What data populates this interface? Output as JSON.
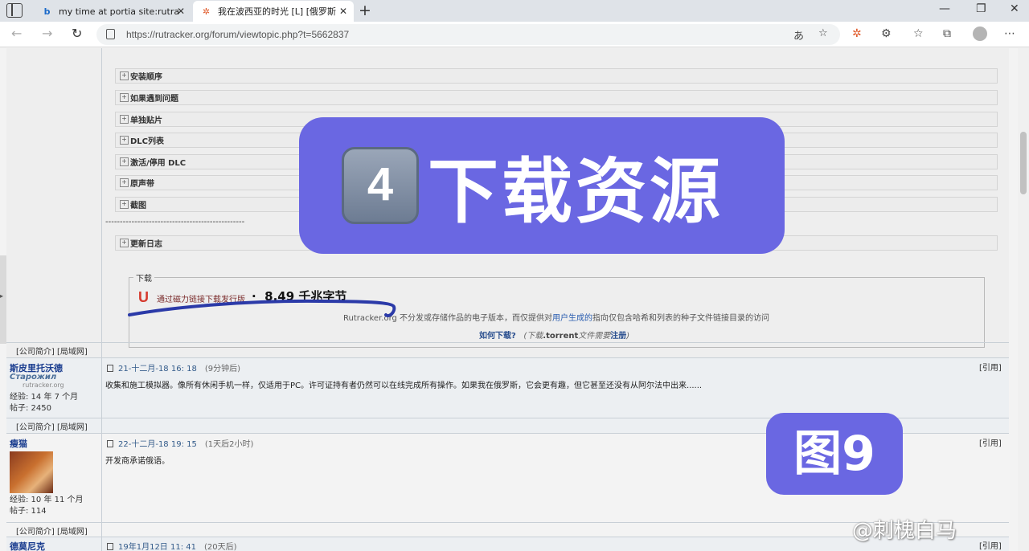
{
  "browser": {
    "tabs": [
      {
        "title": "my time at portia site:rutracker.o",
        "favicon": "bing-icon"
      },
      {
        "title": "我在波西亚的时光 [L] [俄罗斯 + ...",
        "favicon": "rutracker-icon"
      }
    ],
    "url": "https://rutracker.org/forum/viewtopic.php?t=5662837",
    "translate_icon": "あ"
  },
  "spoilers": [
    "安装顺序",
    "如果遇到问题",
    "单独贴片",
    "DLC列表",
    "激活/停用 DLC",
    "原声带",
    "截图"
  ],
  "changelog": "更新日志",
  "separator": "------------------------------------------------",
  "download": {
    "legend": "下载",
    "magnet_icon": "U",
    "magnet_label": "通过磁力链接下载发行版",
    "bullet": "·",
    "size": "8.49 千兆字节",
    "disclaimer_pre": "Rutracker.org 不分发或存储作品的电子版本，而仅提供对",
    "disclaimer_hl": "用户生成的",
    "disclaimer_post": "指向仅包含哈希和列表的种子文件链接目录的访问",
    "howto": "如何下载?",
    "howto_note_pre": "(下载",
    "howto_note_torrent": ".torrent",
    "howto_note_mid": "文件需要",
    "howto_note_reg": "注册",
    "howto_note_end": ")"
  },
  "profile_links": "[公司简介] [局域网]",
  "posts": [
    {
      "username": "斯皮里托沃德",
      "rank": "Старожил",
      "rank_site": "rutracker.org",
      "experience": "经验:   14 年 7 个月",
      "messages": "帖子:   2450",
      "date": "21-十二月-18 16: 18",
      "relative": "(9分钟后)",
      "quote": "[引用]",
      "body": "收集和施工模拟器。像所有休闲手机一样，仅适用于PC。许可证持有者仍然可以在线完成所有操作。如果我在俄罗斯，它会更有趣，但它甚至还没有从阿尔法中出来......"
    },
    {
      "username": "瘦猫",
      "experience": "经验:   10 年 11 个月",
      "messages": "帖子:   114",
      "date": "22-十二月-18 19: 15",
      "relative": "(1天后2小时)",
      "quote": "[引用]",
      "body": "开发商承诺俄语。"
    },
    {
      "username": "德莫尼克",
      "date": "19年1月12日 11: 41",
      "relative": "(20天后)",
      "quote": "[引用]"
    }
  ],
  "overlay": {
    "key_emoji": "4",
    "banner_text": "下载资源",
    "figure_label": "图9",
    "watermark": "@刺槐白马"
  },
  "colors": {
    "overlay_purple": "#6a67e2",
    "username_blue": "#1a3d8f",
    "magnet_red": "#d53a2e",
    "scribble": "#2b3aa8"
  }
}
